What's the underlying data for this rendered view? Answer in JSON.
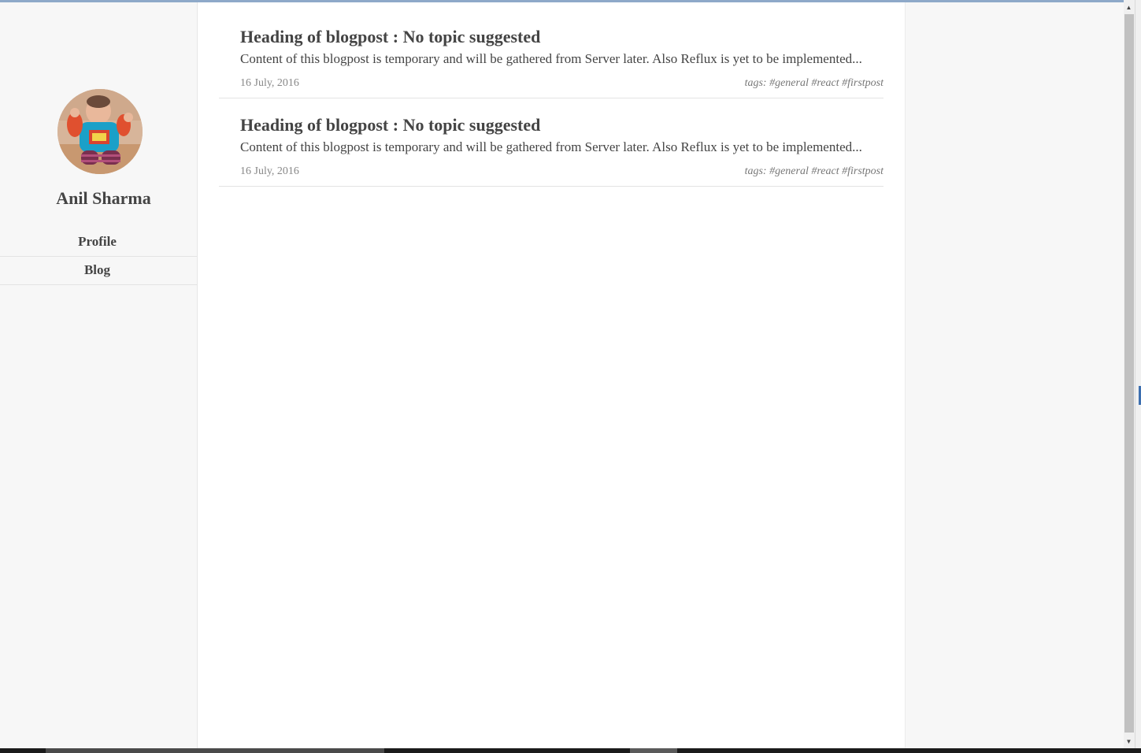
{
  "sidebar": {
    "author_name": "Anil Sharma",
    "nav": [
      {
        "label": "Profile"
      },
      {
        "label": "Blog"
      }
    ]
  },
  "posts": [
    {
      "title": "Heading of blogpost : No topic suggested",
      "excerpt": "Content of this blogpost is temporary and will be gathered from Server later. Also Reflux is yet to be implemented...",
      "date": "16 July, 2016",
      "tags": "tags: #general #react #firstpost"
    },
    {
      "title": "Heading of blogpost : No topic suggested",
      "excerpt": "Content of this blogpost is temporary and will be gathered from Server later. Also Reflux is yet to be implemented...",
      "date": "16 July, 2016",
      "tags": "tags: #general #react #firstpost"
    }
  ],
  "colors": {
    "sidebar_bg": "#f7f7f7",
    "content_bg": "#ffffff",
    "text": "#444444",
    "muted": "#888888"
  }
}
